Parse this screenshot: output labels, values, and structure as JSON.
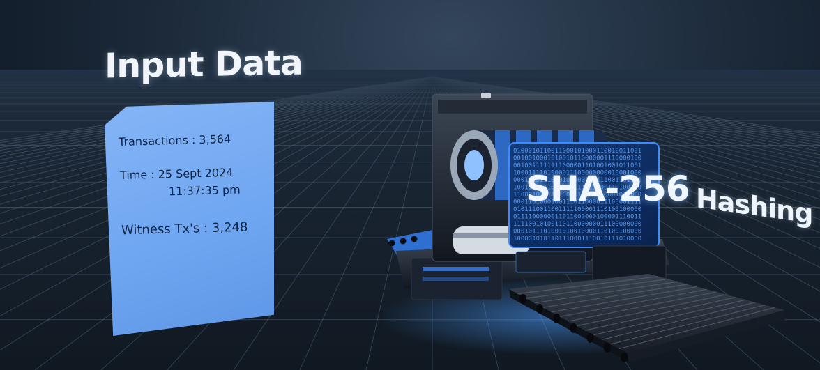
{
  "scene": {
    "title": "Input Data",
    "input_card": {
      "transactions": "Transactions : 3,564",
      "time_line1": "Time :  25 Sept 2024",
      "time_line2": "11:37:35 pm",
      "witness": "Witness Tx's : 3,248"
    },
    "machine": {
      "screen_label": "SHA-256"
    },
    "caption": "Hashing Alg"
  },
  "colors": {
    "card": "#6ea5f1",
    "accent_blue": "#3d8cff",
    "background": "#1c2a3a"
  }
}
